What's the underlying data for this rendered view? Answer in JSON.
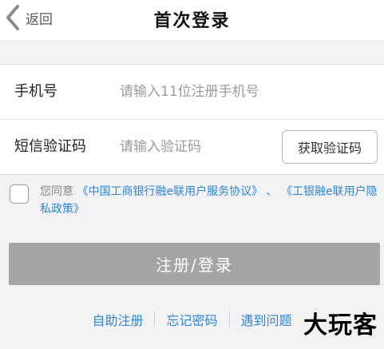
{
  "nav": {
    "back_label": "返回",
    "title": "首次登录"
  },
  "form": {
    "phone": {
      "label": "手机号",
      "placeholder": "请输入11位注册手机号"
    },
    "sms": {
      "label": "短信验证码",
      "placeholder": "请输入验证码",
      "button_label": "获取验证码"
    }
  },
  "agreement": {
    "prefix": "您同意",
    "link1": "《中国工商银行融e联用户服务协议》",
    "separator": "、",
    "link2": "《工银融e联用户隐私政策》"
  },
  "submit_label": "注册/登录",
  "links": [
    {
      "label": "自助注册"
    },
    {
      "label": "忘记密码"
    },
    {
      "label": "遇到问题"
    }
  ],
  "watermark": "大玩客"
}
